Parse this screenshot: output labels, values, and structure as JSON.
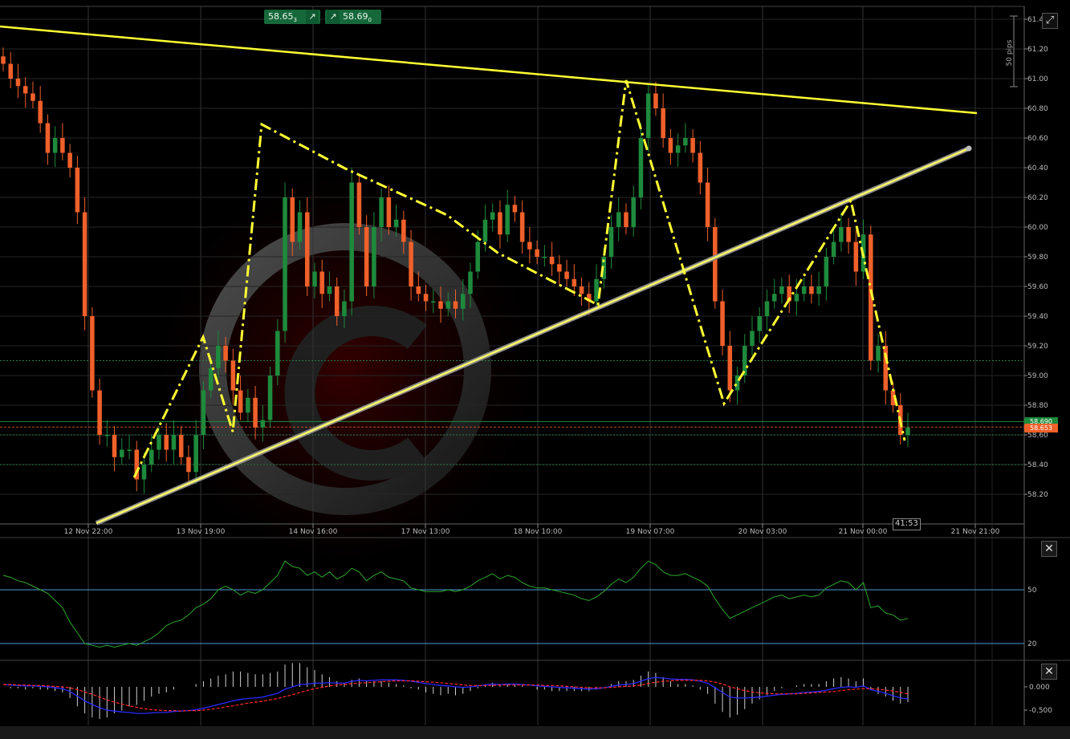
{
  "trade": {
    "sell_price": "58.65",
    "sell_superscript": "3",
    "buy_price": "58.69",
    "buy_superscript": "0",
    "arrow_icon": "arrow-up-right-icon"
  },
  "pips_label": "50 pips",
  "candle_timer": "41:53",
  "price_tags": {
    "green": "58.690",
    "red": "58.653"
  },
  "colors": {
    "bull": "#1e8a3c",
    "bear": "#f0602a",
    "trendline": "#ffff33",
    "rsi": "#2ea82e",
    "macd": "#2a2aff",
    "signal": "#ff2a2a"
  },
  "chart_data": [
    {
      "type": "candlestick",
      "x_tick_labels": [
        "12 Nov 22:00",
        "13 Nov 19:00",
        "14 Nov 16:00",
        "17 Nov 13:00",
        "18 Nov 10:00",
        "19 Nov 07:00",
        "20 Nov 03:00",
        "21 Nov 00:00",
        "21 Nov 21:00"
      ],
      "y_tick_labels": [
        "61.40",
        "61.20",
        "61.00",
        "60.80",
        "60.60",
        "60.40",
        "60.20",
        "60.00",
        "59.80",
        "59.60",
        "59.40",
        "59.20",
        "59.00",
        "58.80",
        "58.60",
        "58.40",
        "58.20"
      ],
      "ylim": [
        58.0,
        61.45
      ],
      "closes": [
        61.1,
        61.0,
        60.95,
        60.9,
        60.85,
        60.7,
        60.5,
        60.6,
        60.5,
        60.4,
        60.1,
        59.4,
        58.9,
        58.6,
        58.6,
        58.45,
        58.5,
        58.5,
        58.3,
        58.4,
        58.5,
        58.6,
        58.5,
        58.6,
        58.45,
        58.35,
        58.6,
        58.9,
        59.05,
        59.2,
        59.1,
        58.9,
        58.75,
        58.85,
        58.65,
        58.7,
        59.0,
        59.3,
        60.2,
        59.9,
        60.1,
        59.6,
        59.7,
        59.55,
        59.6,
        59.4,
        59.5,
        60.3,
        60.0,
        59.6,
        60.0,
        60.2,
        60.0,
        60.05,
        59.9,
        59.6,
        59.55,
        59.5,
        59.5,
        59.45,
        59.5,
        59.45,
        59.55,
        59.7,
        59.9,
        60.05,
        60.1,
        59.95,
        60.15,
        60.1,
        59.9,
        59.85,
        59.8,
        59.8,
        59.75,
        59.7,
        59.65,
        59.6,
        59.55,
        59.5,
        59.65,
        59.8,
        60.0,
        60.1,
        60.0,
        60.2,
        60.6,
        60.9,
        60.8,
        60.6,
        60.5,
        60.55,
        60.6,
        60.5,
        60.3,
        60.0,
        59.5,
        59.2,
        58.9,
        59.0,
        59.2,
        59.3,
        59.4,
        59.5,
        59.55,
        59.6,
        59.5,
        59.55,
        59.6,
        59.55,
        59.6,
        59.8,
        59.9,
        60.0,
        59.9,
        59.7,
        59.95,
        59.1,
        59.2,
        58.9,
        58.8,
        58.6,
        58.65
      ]
    },
    {
      "type": "line",
      "name": "RSI",
      "levels": [
        50,
        20
      ],
      "values": [
        58,
        57,
        55,
        54,
        52,
        50,
        48,
        44,
        40,
        32,
        26,
        20,
        19,
        18,
        19,
        18,
        19,
        20,
        19,
        21,
        23,
        26,
        30,
        32,
        33,
        36,
        40,
        42,
        45,
        50,
        52,
        50,
        47,
        49,
        48,
        50,
        54,
        58,
        66,
        63,
        62,
        58,
        60,
        57,
        60,
        56,
        58,
        62,
        60,
        55,
        58,
        60,
        57,
        56,
        55,
        51,
        50,
        49,
        49,
        49,
        50,
        49,
        50,
        52,
        55,
        57,
        59,
        56,
        58,
        57,
        54,
        52,
        51,
        51,
        50,
        49,
        48,
        47,
        45,
        44,
        46,
        49,
        53,
        56,
        54,
        57,
        62,
        66,
        64,
        60,
        58,
        58,
        59,
        57,
        55,
        52,
        45,
        39,
        34,
        36,
        38,
        40,
        42,
        44,
        46,
        47,
        45,
        46,
        47,
        46,
        47,
        51,
        53,
        55,
        54,
        50,
        54,
        40,
        41,
        37,
        36,
        33,
        34
      ]
    },
    {
      "type": "line",
      "name": "MACD",
      "y_tick_labels": [
        "0.000",
        "-0.500"
      ],
      "ylim": [
        -0.85,
        0.45
      ],
      "macd": [
        0.05,
        0.04,
        0.03,
        0.02,
        0.02,
        0.01,
        0.0,
        -0.02,
        -0.04,
        -0.1,
        -0.2,
        -0.3,
        -0.38,
        -0.45,
        -0.5,
        -0.52,
        -0.54,
        -0.55,
        -0.57,
        -0.57,
        -0.56,
        -0.55,
        -0.55,
        -0.53,
        -0.52,
        -0.51,
        -0.49,
        -0.46,
        -0.42,
        -0.38,
        -0.34,
        -0.3,
        -0.27,
        -0.25,
        -0.24,
        -0.22,
        -0.18,
        -0.14,
        -0.05,
        0.0,
        0.05,
        0.06,
        0.08,
        0.08,
        0.09,
        0.08,
        0.08,
        0.12,
        0.14,
        0.13,
        0.14,
        0.15,
        0.15,
        0.15,
        0.14,
        0.12,
        0.1,
        0.07,
        0.05,
        0.03,
        0.02,
        0.0,
        -0.01,
        0.0,
        0.02,
        0.04,
        0.06,
        0.05,
        0.06,
        0.06,
        0.05,
        0.04,
        0.02,
        0.01,
        0.0,
        -0.01,
        -0.02,
        -0.03,
        -0.04,
        -0.05,
        -0.04,
        -0.02,
        0.01,
        0.04,
        0.05,
        0.07,
        0.12,
        0.18,
        0.2,
        0.19,
        0.17,
        0.16,
        0.16,
        0.15,
        0.12,
        0.08,
        -0.02,
        -0.12,
        -0.22,
        -0.24,
        -0.24,
        -0.23,
        -0.22,
        -0.2,
        -0.18,
        -0.16,
        -0.15,
        -0.14,
        -0.12,
        -0.11,
        -0.1,
        -0.07,
        -0.04,
        -0.01,
        0.0,
        -0.01,
        0.02,
        -0.06,
        -0.1,
        -0.14,
        -0.19,
        -0.24,
        -0.26
      ],
      "signal": [
        0.05,
        0.05,
        0.04,
        0.04,
        0.03,
        0.03,
        0.02,
        0.01,
        0.0,
        -0.02,
        -0.06,
        -0.11,
        -0.16,
        -0.22,
        -0.28,
        -0.33,
        -0.37,
        -0.41,
        -0.44,
        -0.47,
        -0.49,
        -0.5,
        -0.51,
        -0.51,
        -0.52,
        -0.51,
        -0.51,
        -0.5,
        -0.48,
        -0.46,
        -0.43,
        -0.41,
        -0.38,
        -0.35,
        -0.33,
        -0.31,
        -0.28,
        -0.25,
        -0.21,
        -0.17,
        -0.12,
        -0.08,
        -0.04,
        -0.01,
        0.02,
        0.04,
        0.05,
        0.07,
        0.08,
        0.09,
        0.1,
        0.11,
        0.12,
        0.13,
        0.13,
        0.13,
        0.12,
        0.11,
        0.1,
        0.09,
        0.07,
        0.06,
        0.04,
        0.03,
        0.03,
        0.03,
        0.03,
        0.04,
        0.04,
        0.04,
        0.04,
        0.04,
        0.04,
        0.03,
        0.03,
        0.02,
        0.01,
        0.0,
        -0.01,
        -0.02,
        -0.02,
        -0.02,
        -0.01,
        0.0,
        0.01,
        0.02,
        0.04,
        0.07,
        0.1,
        0.12,
        0.13,
        0.14,
        0.14,
        0.14,
        0.14,
        0.13,
        0.1,
        0.06,
        0.0,
        -0.04,
        -0.08,
        -0.11,
        -0.13,
        -0.14,
        -0.15,
        -0.15,
        -0.15,
        -0.15,
        -0.14,
        -0.13,
        -0.12,
        -0.11,
        -0.1,
        -0.08,
        -0.06,
        -0.05,
        -0.04,
        -0.04,
        -0.05,
        -0.07,
        -0.09,
        -0.12,
        -0.15
      ]
    }
  ]
}
